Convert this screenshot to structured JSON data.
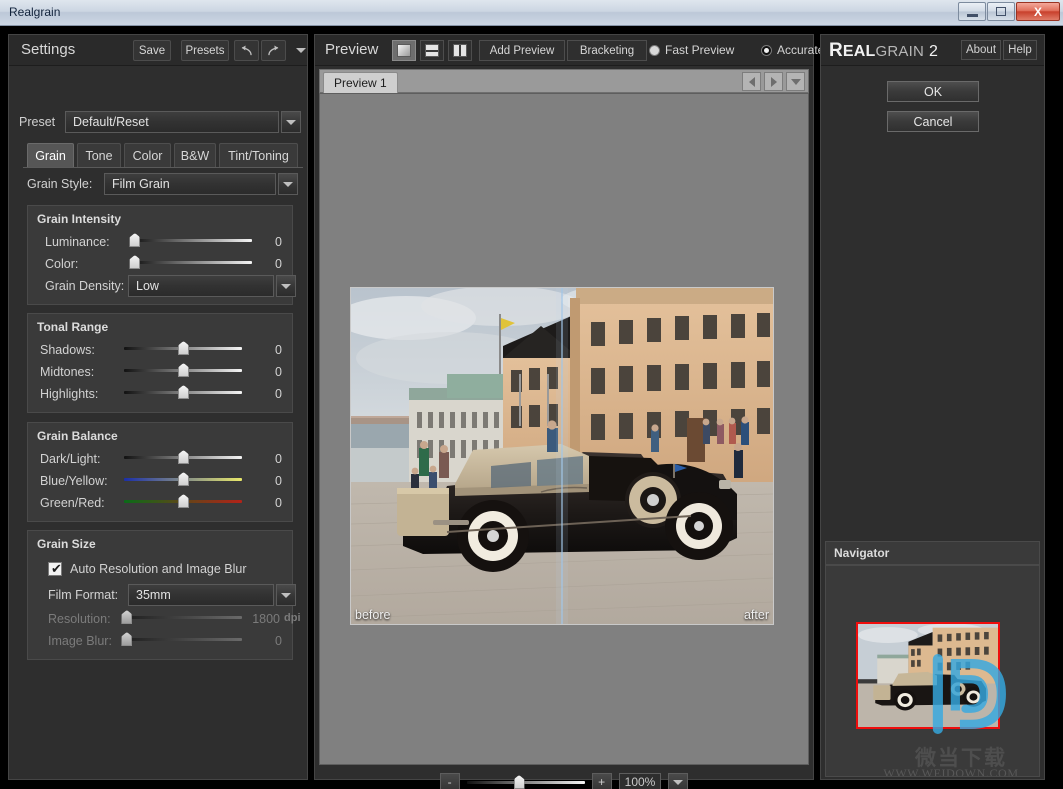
{
  "window": {
    "title": "Realgrain",
    "minimize_label": "Minimize",
    "maximize_label": "Maximize",
    "close_label": "X"
  },
  "settings": {
    "title": "Settings",
    "save_label": "Save",
    "presets_label": "Presets",
    "undo_icon": "undo-icon",
    "redo_icon": "redo-icon",
    "menu_icon": "chevron-down-icon",
    "preset_label": "Preset",
    "preset_value": "Default/Reset",
    "tabs": [
      {
        "label": "Grain",
        "active": true
      },
      {
        "label": "Tone",
        "active": false
      },
      {
        "label": "Color",
        "active": false
      },
      {
        "label": "B&W",
        "active": false
      },
      {
        "label": "Tint/Toning",
        "active": false
      }
    ],
    "grain_style_label": "Grain Style:",
    "grain_style_value": "Film Grain",
    "sections": {
      "grain_intensity": {
        "title": "Grain Intensity",
        "rows": [
          {
            "label": "Luminance:",
            "value": "0",
            "pos": 0
          },
          {
            "label": "Color:",
            "value": "0",
            "pos": 0
          }
        ],
        "density_label": "Grain Density:",
        "density_value": "Low"
      },
      "tonal_range": {
        "title": "Tonal Range",
        "rows": [
          {
            "label": "Shadows:",
            "value": "0",
            "pos": 50
          },
          {
            "label": "Midtones:",
            "value": "0",
            "pos": 50
          },
          {
            "label": "Highlights:",
            "value": "0",
            "pos": 50
          }
        ]
      },
      "grain_balance": {
        "title": "Grain Balance",
        "rows": [
          {
            "label": "Dark/Light:",
            "value": "0",
            "pos": 50,
            "kind": "plain"
          },
          {
            "label": "Blue/Yellow:",
            "value": "0",
            "pos": 50,
            "kind": "by"
          },
          {
            "label": "Green/Red:",
            "value": "0",
            "pos": 50,
            "kind": "gr"
          }
        ]
      },
      "grain_size": {
        "title": "Grain Size",
        "auto_label": "Auto Resolution and Image Blur",
        "auto_checked": true,
        "film_format_label": "Film Format:",
        "film_format_value": "35mm",
        "resolution_label": "Resolution:",
        "resolution_value": "1800",
        "resolution_unit": "dpi",
        "blur_label": "Image Blur:",
        "blur_value": "0"
      }
    }
  },
  "preview": {
    "title": "Preview",
    "view_modes": [
      {
        "name": "single-view-icon",
        "active": true
      },
      {
        "name": "horizontal-split-view-icon",
        "active": false
      },
      {
        "name": "vertical-split-view-icon",
        "active": false
      }
    ],
    "add_preview_label": "Add Preview",
    "bracketing_label": "Bracketing",
    "quality_options": [
      {
        "label": "Fast Preview",
        "selected": false
      },
      {
        "label": "Accurate",
        "selected": true
      }
    ],
    "tab_label": "Preview 1",
    "nav_prev_icon": "triangle-left-icon",
    "nav_next_icon": "triangle-right-icon",
    "nav_menu_icon": "chevron-down-icon",
    "before_label": "before",
    "after_label": "after",
    "zoom_out_label": "-",
    "zoom_in_label": "+",
    "zoom_value": "100%",
    "zoom_menu_icon": "chevron-down-icon"
  },
  "right": {
    "brand_part1": "R",
    "brand_part1b": "EAL",
    "brand_part2": "GRAIN",
    "brand_part3": "2",
    "about_label": "About",
    "help_label": "Help",
    "ok_label": "OK",
    "cancel_label": "Cancel",
    "navigator_title": "Navigator",
    "watermark_cn": "微当下载",
    "watermark_url": "WWW.WEIDOWN.COM"
  },
  "colors": {
    "accent_red": "#ef0d0d",
    "watermark_blue": "#36a9e1",
    "panel_bg": "#2e2e2e",
    "section_bg": "#3a3a3a",
    "canvas_bg": "#808080"
  }
}
